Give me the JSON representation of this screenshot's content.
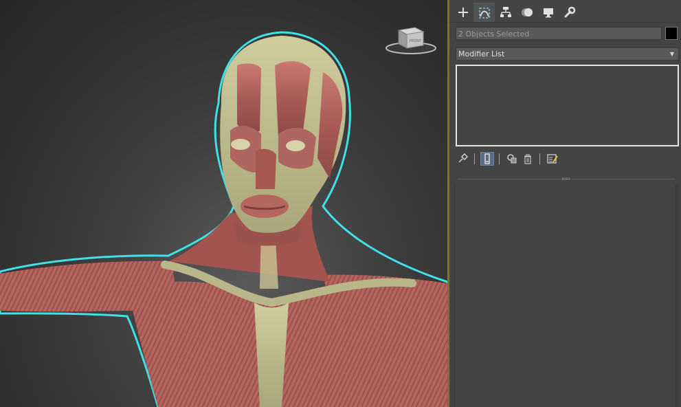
{
  "viewport": {
    "viewcube_face_label": "FRONT",
    "background_color": "#3c3c3c",
    "selection_outline_color": "#3fe0e6"
  },
  "command_panel": {
    "tabs": [
      {
        "name": "create-tab",
        "icon": "plus-icon",
        "active": false
      },
      {
        "name": "modify-tab",
        "icon": "modify-curve-icon",
        "active": true
      },
      {
        "name": "hierarchy-tab",
        "icon": "hierarchy-icon",
        "active": false
      },
      {
        "name": "motion-tab",
        "icon": "motion-icon",
        "active": false
      },
      {
        "name": "display-tab",
        "icon": "display-monitor-icon",
        "active": false
      },
      {
        "name": "utilities-tab",
        "icon": "wrench-icon",
        "active": false
      }
    ],
    "selection_name": "2 Objects Selected",
    "object_color": "#000000",
    "modifier_list_label": "Modifier List",
    "stack_toolbar": [
      {
        "name": "pin-stack-button",
        "icon": "pin-icon"
      },
      {
        "name": "show-end-result-button",
        "icon": "end-result-icon",
        "active": true
      },
      {
        "name": "make-unique-button",
        "icon": "make-unique-icon"
      },
      {
        "name": "remove-modifier-button",
        "icon": "trash-icon"
      },
      {
        "name": "configure-modifier-sets-button",
        "icon": "configure-sets-icon"
      }
    ],
    "accent_color": "#8a6d1e"
  }
}
